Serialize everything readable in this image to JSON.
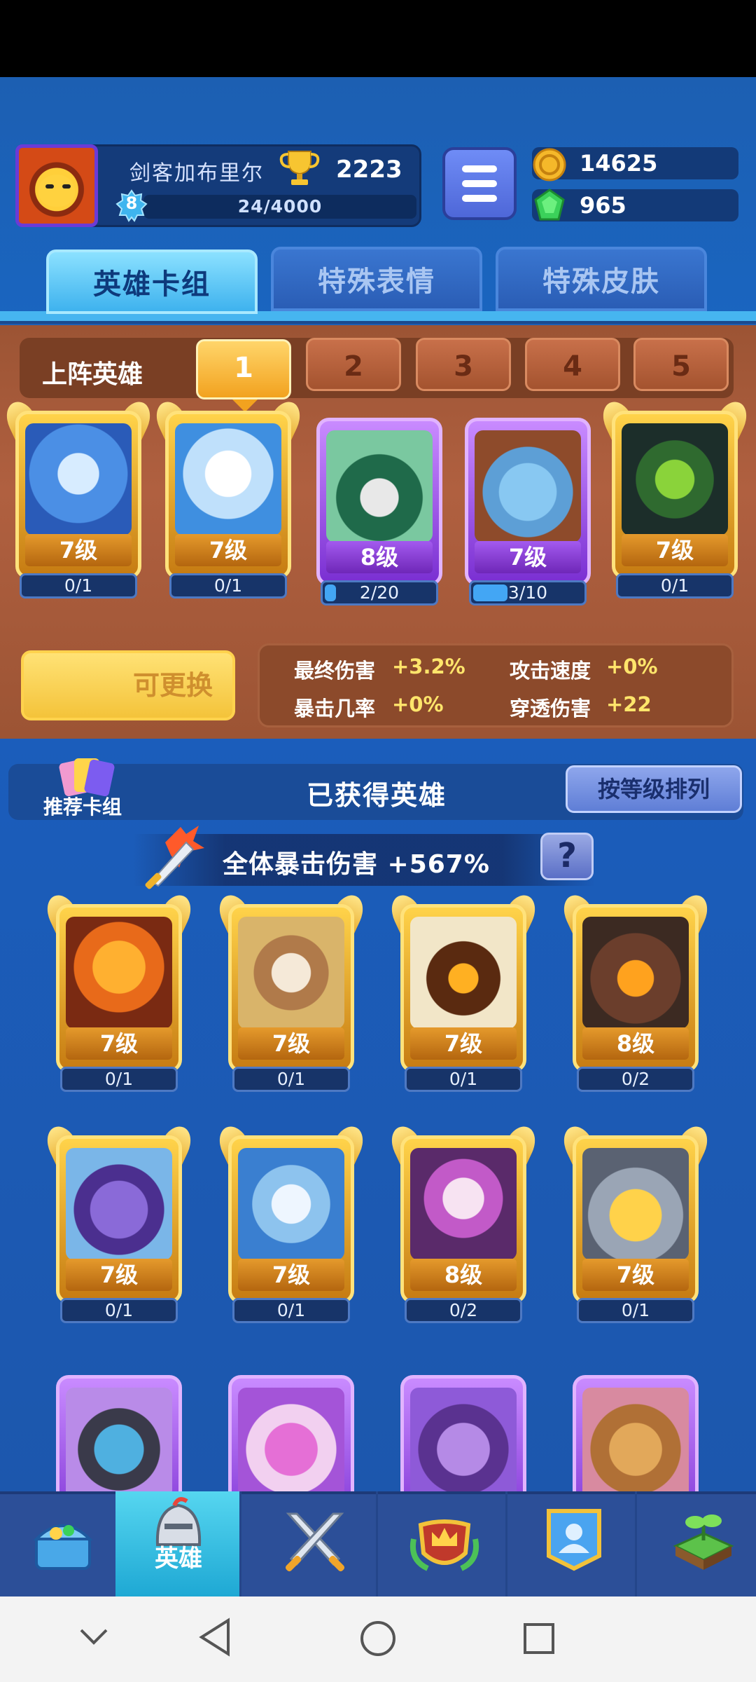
{
  "header": {
    "player_name": "剑客加布里尔",
    "trophies": "2223",
    "level": "8",
    "xp": "24/4000",
    "gold": "14625",
    "gems": "965"
  },
  "tabs": [
    "英雄卡组",
    "特殊表情",
    "特殊皮肤"
  ],
  "deck": {
    "title": "上阵英雄",
    "slots": [
      "1",
      "2",
      "3",
      "4",
      "5"
    ],
    "selected_slot": "1",
    "cards": [
      {
        "level": "7级",
        "progress": "0/1",
        "rarity": "gold",
        "fill": 0.0
      },
      {
        "level": "7级",
        "progress": "0/1",
        "rarity": "gold",
        "fill": 0.0
      },
      {
        "level": "8级",
        "progress": "2/20",
        "rarity": "purple",
        "fill": 0.1
      },
      {
        "level": "7级",
        "progress": "3/10",
        "rarity": "purple",
        "fill": 0.3
      },
      {
        "level": "7级",
        "progress": "0/1",
        "rarity": "gold",
        "fill": 0.0
      }
    ],
    "replace_label": "可更换",
    "stats": [
      {
        "label": "最终伤害",
        "value": "+3.2%"
      },
      {
        "label": "攻击速度",
        "value": "+0%"
      },
      {
        "label": "暴击几率",
        "value": "+0%"
      },
      {
        "label": "穿透伤害",
        "value": "+22"
      }
    ]
  },
  "owned": {
    "recommend_label": "推荐卡组",
    "title": "已获得英雄",
    "sort_label": "按等级排列",
    "crit_text": "全体暴击伤害 +567%",
    "help_label": "?",
    "cards": [
      {
        "level": "7级",
        "progress": "0/1",
        "rarity": "gold"
      },
      {
        "level": "7级",
        "progress": "0/1",
        "rarity": "gold"
      },
      {
        "level": "7级",
        "progress": "0/1",
        "rarity": "gold"
      },
      {
        "level": "8级",
        "progress": "0/2",
        "rarity": "gold"
      },
      {
        "level": "7级",
        "progress": "0/1",
        "rarity": "gold"
      },
      {
        "level": "7级",
        "progress": "0/1",
        "rarity": "gold"
      },
      {
        "level": "8级",
        "progress": "0/2",
        "rarity": "gold"
      },
      {
        "level": "7级",
        "progress": "0/1",
        "rarity": "gold"
      }
    ]
  },
  "bottom_nav": [
    {
      "icon": "treasure-chest-icon",
      "label": ""
    },
    {
      "icon": "knight-helmet-icon",
      "label": "英雄",
      "active": true
    },
    {
      "icon": "crossed-swords-icon",
      "label": ""
    },
    {
      "icon": "crown-shield-icon",
      "label": ""
    },
    {
      "icon": "team-icon",
      "label": ""
    },
    {
      "icon": "island-sprout-icon",
      "label": ""
    }
  ],
  "colors": {
    "background": "#1b5fb5",
    "deck_panel": "#a45a38",
    "gold_card": "#f2b431",
    "purple_card": "#9b4ee6",
    "accent_yellow": "#ffe56b"
  }
}
